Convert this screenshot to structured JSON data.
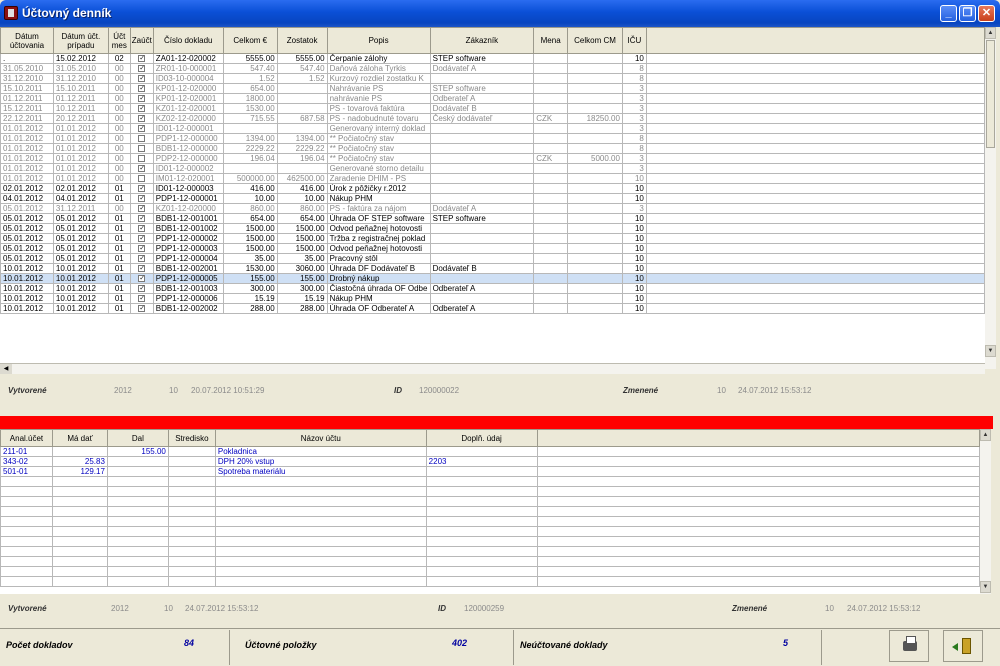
{
  "window": {
    "title": "Účtovný denník",
    "btn_min": "_",
    "btn_max": "❐",
    "btn_close": "✕"
  },
  "journal": {
    "headers": [
      "Dátum účtovania",
      "Dátum účt. prípadu",
      "Účt mes",
      "Zaúčt",
      "Číslo dokladu",
      "Celkom €",
      "Zostatok",
      "Popis",
      "Zákazník",
      "Mena",
      "Celkom CM",
      "IČU"
    ],
    "rows": [
      {
        "d1": ".",
        "d2": "15.02.2012",
        "m": "02",
        "chk": true,
        "doc": "ZA01-12-020002",
        "total": "5555.00",
        "bal": "5555.00",
        "desc": "Čerpanie zálohy",
        "cust": "STEP software",
        "cur": "",
        "cm": "",
        "icu": "10",
        "gray": false
      },
      {
        "d1": "31.05.2010",
        "d2": "31.05.2010",
        "m": "00",
        "chk": true,
        "doc": "ZR01-10-000001",
        "total": "547.40",
        "bal": "547.40",
        "desc": "Daňová záloha Tyrkis",
        "cust": "Dodávateľ A",
        "cur": "",
        "cm": "",
        "icu": "8",
        "gray": true
      },
      {
        "d1": "31.12.2010",
        "d2": "31.12.2010",
        "m": "00",
        "chk": true,
        "doc": "ID03-10-000004",
        "total": "1.52",
        "bal": "1.52",
        "desc": "Kurzový rozdiel zostatku K",
        "cust": "",
        "cur": "",
        "cm": "",
        "icu": "8",
        "gray": true
      },
      {
        "d1": "15.10.2011",
        "d2": "15.10.2011",
        "m": "00",
        "chk": true,
        "doc": "KP01-12-020000",
        "total": "654.00",
        "bal": "",
        "desc": "Nahrávanie PS",
        "cust": "STEP software",
        "cur": "",
        "cm": "",
        "icu": "3",
        "gray": true
      },
      {
        "d1": "01.12.2011",
        "d2": "01.12.2011",
        "m": "00",
        "chk": true,
        "doc": "KP01-12-020001",
        "total": "1800.00",
        "bal": "",
        "desc": "nahrávanie PS",
        "cust": "Odberateľ A",
        "cur": "",
        "cm": "",
        "icu": "3",
        "gray": true
      },
      {
        "d1": "15.12.2011",
        "d2": "10.12.2011",
        "m": "00",
        "chk": true,
        "doc": "KZ01-12-020001",
        "total": "1530.00",
        "bal": "",
        "desc": "PS - tovarová faktúra",
        "cust": "Dodávateľ B",
        "cur": "",
        "cm": "",
        "icu": "3",
        "gray": true
      },
      {
        "d1": "22.12.2011",
        "d2": "20.12.2011",
        "m": "00",
        "chk": true,
        "doc": "KZ02-12-020000",
        "total": "715.55",
        "bal": "687.58",
        "desc": "PS - nadobudnuté tovaru",
        "cust": "Český dodávateľ",
        "cur": "CZK",
        "cm": "18250.00",
        "icu": "3",
        "gray": true
      },
      {
        "d1": "01.01.2012",
        "d2": "01.01.2012",
        "m": "00",
        "chk": true,
        "doc": "ID01-12-000001",
        "total": "",
        "bal": "",
        "desc": "Generovaný interný doklad",
        "cust": "",
        "cur": "",
        "cm": "",
        "icu": "3",
        "gray": true
      },
      {
        "d1": "01.01.2012",
        "d2": "01.01.2012",
        "m": "00",
        "chk": false,
        "doc": "PDP1-12-000000",
        "total": "1394.00",
        "bal": "1394.00",
        "desc": "** Počiatočný stav",
        "cust": "",
        "cur": "",
        "cm": "",
        "icu": "8",
        "gray": true
      },
      {
        "d1": "01.01.2012",
        "d2": "01.01.2012",
        "m": "00",
        "chk": false,
        "doc": "BDB1-12-000000",
        "total": "2229.22",
        "bal": "2229.22",
        "desc": "** Počiatočný stav",
        "cust": "",
        "cur": "",
        "cm": "",
        "icu": "8",
        "gray": true
      },
      {
        "d1": "01.01.2012",
        "d2": "01.01.2012",
        "m": "00",
        "chk": false,
        "doc": "PDP2-12-000000",
        "total": "196.04",
        "bal": "196.04",
        "desc": "** Počiatočný stav",
        "cust": "",
        "cur": "CZK",
        "cm": "5000.00",
        "icu": "3",
        "gray": true
      },
      {
        "d1": "01.01.2012",
        "d2": "01.01.2012",
        "m": "00",
        "chk": true,
        "doc": "ID01-12-000002",
        "total": "",
        "bal": "",
        "desc": "Generované storno detailu",
        "cust": "",
        "cur": "",
        "cm": "",
        "icu": "3",
        "gray": true
      },
      {
        "d1": "01.01.2012",
        "d2": "01.01.2012",
        "m": "00",
        "chk": false,
        "doc": "IM01-12-020001",
        "total": "500000.00",
        "bal": "462500.00",
        "desc": "Zaradenie DHIM - PS",
        "cust": "",
        "cur": "",
        "cm": "",
        "icu": "10",
        "gray": true
      },
      {
        "d1": "02.01.2012",
        "d2": "02.01.2012",
        "m": "01",
        "chk": true,
        "doc": "ID01-12-000003",
        "total": "416.00",
        "bal": "416.00",
        "desc": "Úrok z pôžičky r.2012",
        "cust": "",
        "cur": "",
        "cm": "",
        "icu": "10",
        "gray": false
      },
      {
        "d1": "04.01.2012",
        "d2": "04.01.2012",
        "m": "01",
        "chk": true,
        "doc": "PDP1-12-000001",
        "total": "10.00",
        "bal": "10.00",
        "desc": "Nákup PHM",
        "cust": "",
        "cur": "",
        "cm": "",
        "icu": "10",
        "gray": false
      },
      {
        "d1": "05.01.2012",
        "d2": "31.12.2011",
        "m": "00",
        "chk": true,
        "doc": "KZ01-12-020000",
        "total": "860.00",
        "bal": "860.00",
        "desc": "PS - faktúra za nájom",
        "cust": "Dodávateľ A",
        "cur": "",
        "cm": "",
        "icu": "3",
        "gray": true
      },
      {
        "d1": "05.01.2012",
        "d2": "05.01.2012",
        "m": "01",
        "chk": true,
        "doc": "BDB1-12-001001",
        "total": "654.00",
        "bal": "654.00",
        "desc": "Úhrada OF STEP software",
        "cust": "STEP software",
        "cur": "",
        "cm": "",
        "icu": "10",
        "gray": false
      },
      {
        "d1": "05.01.2012",
        "d2": "05.01.2012",
        "m": "01",
        "chk": true,
        "doc": "BDB1-12-001002",
        "total": "1500.00",
        "bal": "1500.00",
        "desc": "Odvod peňažnej hotovosti",
        "cust": "",
        "cur": "",
        "cm": "",
        "icu": "10",
        "gray": false
      },
      {
        "d1": "05.01.2012",
        "d2": "05.01.2012",
        "m": "01",
        "chk": true,
        "doc": "PDP1-12-000002",
        "total": "1500.00",
        "bal": "1500.00",
        "desc": "Tržba z registračnej poklad",
        "cust": "",
        "cur": "",
        "cm": "",
        "icu": "10",
        "gray": false
      },
      {
        "d1": "05.01.2012",
        "d2": "05.01.2012",
        "m": "01",
        "chk": true,
        "doc": "PDP1-12-000003",
        "total": "1500.00",
        "bal": "1500.00",
        "desc": "Odvod peňažnej hotovosti",
        "cust": "",
        "cur": "",
        "cm": "",
        "icu": "10",
        "gray": false
      },
      {
        "d1": "05.01.2012",
        "d2": "05.01.2012",
        "m": "01",
        "chk": true,
        "doc": "PDP1-12-000004",
        "total": "35.00",
        "bal": "35.00",
        "desc": "Pracovný stôl",
        "cust": "",
        "cur": "",
        "cm": "",
        "icu": "10",
        "gray": false
      },
      {
        "d1": "10.01.2012",
        "d2": "10.01.2012",
        "m": "01",
        "chk": true,
        "doc": "BDB1-12-002001",
        "total": "1530.00",
        "bal": "3060.00",
        "desc": "Úhrada DF Dodávateľ B",
        "cust": "Dodávateľ B",
        "cur": "",
        "cm": "",
        "icu": "10",
        "gray": false
      },
      {
        "d1": "10.01.2012",
        "d2": "10.01.2012",
        "m": "01",
        "chk": true,
        "doc": "PDP1-12-000005",
        "total": "155.00",
        "bal": "155.00",
        "desc": "Drobný nákup",
        "cust": "",
        "cur": "",
        "cm": "",
        "icu": "10",
        "gray": false,
        "sel": true
      },
      {
        "d1": "10.01.2012",
        "d2": "10.01.2012",
        "m": "01",
        "chk": true,
        "doc": "BDB1-12-001003",
        "total": "300.00",
        "bal": "300.00",
        "desc": "Čiastočná úhrada OF Odbe",
        "cust": "Odberateľ A",
        "cur": "",
        "cm": "",
        "icu": "10",
        "gray": false
      },
      {
        "d1": "10.01.2012",
        "d2": "10.01.2012",
        "m": "01",
        "chk": true,
        "doc": "PDP1-12-000006",
        "total": "15.19",
        "bal": "15.19",
        "desc": "Nákup PHM",
        "cust": "",
        "cur": "",
        "cm": "",
        "icu": "10",
        "gray": false
      },
      {
        "d1": "10.01.2012",
        "d2": "10.01.2012",
        "m": "01",
        "chk": true,
        "doc": "BDB1-12-002002",
        "total": "288.00",
        "bal": "288.00",
        "desc": "Úhrada OF Odberateľ A",
        "cust": "Odberateľ A",
        "cur": "",
        "cm": "",
        "icu": "10",
        "gray": false
      }
    ]
  },
  "info_top": {
    "created_label": "Vytvorené",
    "year": "2012",
    "num": "10",
    "created": "20.07.2012 10:51:29",
    "id_label": "ID",
    "id": "120000022",
    "changed_label": "Zmenené",
    "num2": "10",
    "changed": "24.07.2012 15:53:12"
  },
  "detail": {
    "headers": [
      "Anal.účet",
      "Má dať",
      "Dal",
      "Stredisko",
      "Názov účtu",
      "Doplň. údaj"
    ],
    "rows": [
      {
        "acc": "211-01",
        "md": "",
        "dal": "155.00",
        "str": "",
        "name": "Pokladnica",
        "extra": ""
      },
      {
        "acc": "343-02",
        "md": "25.83",
        "dal": "",
        "str": "",
        "name": "DPH 20% vstup",
        "extra": "2203"
      },
      {
        "acc": "501-01",
        "md": "129.17",
        "dal": "",
        "str": "",
        "name": "Spotreba materiálu",
        "extra": ""
      }
    ]
  },
  "info_bottom": {
    "created_label": "Vytvorené",
    "year": "2012",
    "num": "10",
    "created": "24.07.2012 15:53:12",
    "id_label": "ID",
    "id": "120000259",
    "changed_label": "Zmenené",
    "num2": "10",
    "changed": "24.07.2012 15:53:12"
  },
  "status": {
    "docs_label": "Počet dokladov",
    "docs_value": "84",
    "items_label": "Účtovné položky",
    "items_value": "402",
    "unposted_label": "Neúčtované doklady",
    "unposted_value": "5"
  },
  "icons": {
    "print": "printer-icon",
    "exit": "exit-door-icon"
  }
}
